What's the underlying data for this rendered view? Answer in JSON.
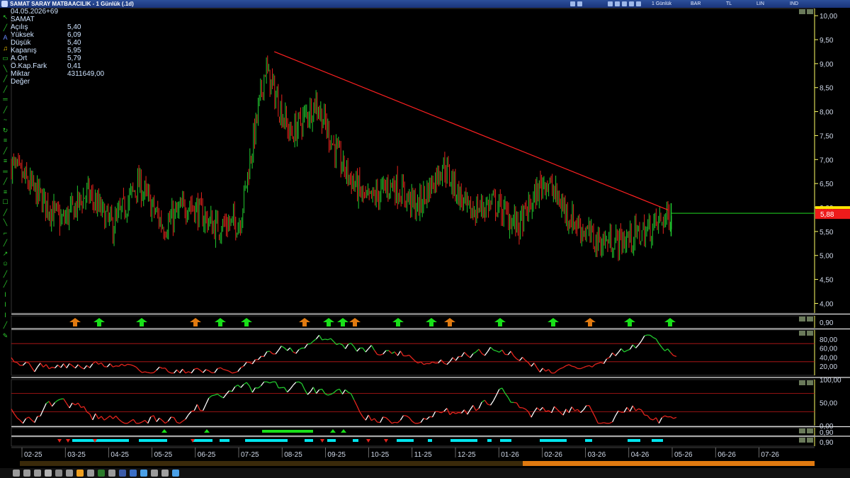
{
  "window": {
    "title": "SAMAT SARAY MATBAACILIK - 1 Günlük (.1d)",
    "period_label": "1 Günlük",
    "mode_labels": [
      "BAR",
      "TL",
      "LIN",
      "IND"
    ]
  },
  "info": {
    "date": "04.05.2026+69",
    "symbol": "SAMAT",
    "rows": [
      {
        "label": "Açılış",
        "value": "5,40"
      },
      {
        "label": "Yüksek",
        "value": "6,09"
      },
      {
        "label": "Düşük",
        "value": "5,40"
      },
      {
        "label": "Kapanış",
        "value": "5,95"
      },
      {
        "label": "A.Ort",
        "value": "5,79"
      },
      {
        "label": "Ö.Kap.Fark",
        "value": "0,41"
      },
      {
        "label": "Miktar",
        "value": "4311649,00"
      },
      {
        "label": "Değer",
        "value": ""
      }
    ]
  },
  "colors": {
    "up": "#22c92f",
    "down": "#e5241d",
    "trendline": "#ff2020",
    "price_line": "#22d822",
    "price_tag_bg": "#ee1b1b",
    "axis_text": "#cfd8e8",
    "signal_green": "#18e018",
    "signal_orange": "#e07a10",
    "cyan": "#00e5ee"
  },
  "price_axis": {
    "ticks": [
      "10,00",
      "9,50",
      "9,00",
      "8,50",
      "8,00",
      "7,50",
      "7,00",
      "6,50",
      "6,00",
      "5,50",
      "5,00",
      "4,50",
      "4,00"
    ],
    "last_price": "5,88"
  },
  "time_axis": {
    "labels": [
      "02-25",
      "03-25",
      "04-25",
      "05-25",
      "06-25",
      "07-25",
      "08-25",
      "09-25",
      "10-25",
      "11-25",
      "12-25",
      "01-26",
      "02-26",
      "03-26",
      "04-26",
      "05-26",
      "06-26",
      "07-26"
    ]
  },
  "panels": {
    "signal": {
      "axis": [
        "0,90"
      ]
    },
    "osc1": {
      "axis": [
        "80,00",
        "60,00",
        "40,00",
        "20,00"
      ],
      "upper": 70,
      "lower": 30
    },
    "osc2": {
      "axis": [
        "100,00",
        "50,00",
        "0,00"
      ],
      "upper": 70,
      "lower": 30
    },
    "strip1": {
      "axis": [
        "0,90"
      ]
    },
    "strip2": {
      "axis": [
        "0,90"
      ]
    }
  },
  "chart_data": {
    "type": "candlestick",
    "symbol": "SAMAT",
    "ylim": [
      3.8,
      10.15
    ],
    "x": [
      "02-25",
      "03-25",
      "04-25",
      "05-25",
      "06-25",
      "07-25",
      "08-25",
      "09-25",
      "10-25",
      "11-25",
      "12-25",
      "01-26",
      "02-26",
      "03-26",
      "04-26",
      "05-26"
    ],
    "close_path": [
      6.9,
      6.3,
      5.7,
      6.3,
      5.6,
      6.5,
      5.6,
      6.1,
      5.6,
      5.7,
      8.9,
      7.5,
      8.2,
      6.9,
      6.1,
      6.5,
      6.0,
      6.9,
      5.9,
      6.1,
      5.6,
      6.6,
      5.8,
      5.3,
      5.3,
      5.5,
      5.88
    ],
    "trendline": [
      {
        "date": "08-25",
        "price": 9.25
      },
      {
        "date": "05-26",
        "price": 5.95
      }
    ],
    "last": {
      "open": 5.4,
      "high": 6.09,
      "low": 5.4,
      "close": 5.95
    }
  }
}
